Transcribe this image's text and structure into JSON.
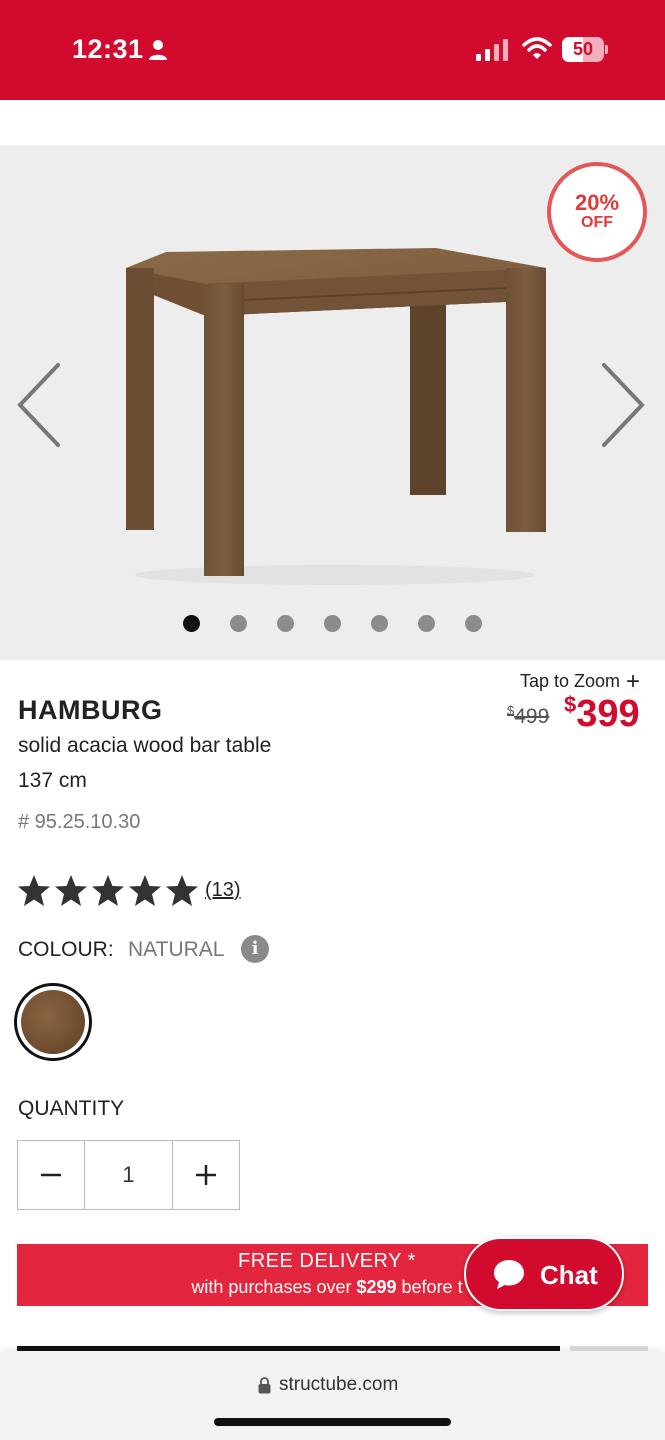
{
  "status_bar": {
    "time": "12:31",
    "battery_level": "50",
    "background": "#d20a2e"
  },
  "gallery": {
    "badge_percent": "20%",
    "badge_off": "OFF",
    "slide_count": 7,
    "active_slide": 0
  },
  "zoom": {
    "label": "Tap to Zoom",
    "icon": "+"
  },
  "price": {
    "old_currency": "$",
    "old_value": "499",
    "new_currency": "$",
    "new_value": "399",
    "accent": "#d20a2e"
  },
  "product": {
    "brand": "HAMBURG",
    "description_line1": "solid acacia wood bar table",
    "description_line2": "137 cm",
    "sku": "# 95.25.10.30"
  },
  "reviews": {
    "rating": 5,
    "max": 5,
    "count": "(13)"
  },
  "colour": {
    "label": "COLOUR:",
    "value": "NATURAL",
    "info_icon": "i"
  },
  "quantity": {
    "label": "QUANTITY",
    "value": "1"
  },
  "promo": {
    "line1": "FREE DELIVERY *",
    "line2_prefix": "with purchases over ",
    "line2_amount": "$299",
    "line2_suffix": " before t"
  },
  "chat": {
    "label": "Chat"
  },
  "browser": {
    "url": "structube.com"
  }
}
